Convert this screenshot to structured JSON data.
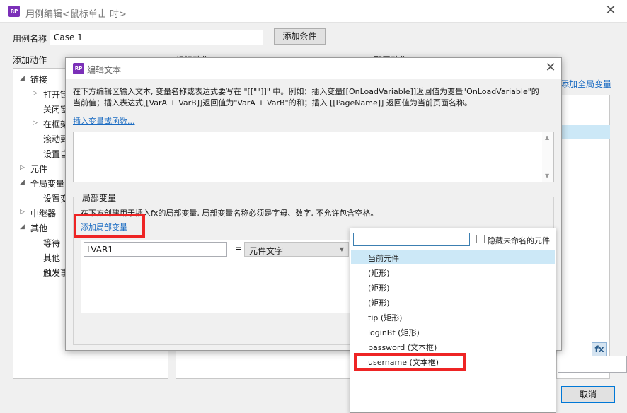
{
  "main_window": {
    "title": "用例编辑<鼠标单击 时>",
    "case_name_label": "用例名称",
    "case_name_value": "Case 1",
    "add_condition_label": "添加条件",
    "add_action_header": "添加动作",
    "organize_action_header": "组织动作",
    "config_action_header": "配置动作",
    "add_global_var_link": "添加全局变量",
    "cancel_label": "取消",
    "fx_label": "fx"
  },
  "tree": {
    "links": "链接",
    "open_link": "打开链",
    "close_window": "关闭窗",
    "in_frame": "在框架",
    "scroll_to": "滚动到",
    "set_adaptive": "设置自",
    "widgets": "元件",
    "global_var": "全局变量",
    "set_var": "设置变",
    "repeater": "中继器",
    "other": "其他",
    "wait": "等待",
    "other_sub": "其他",
    "trigger_event": "触发事"
  },
  "edit_dialog": {
    "title": "编辑文本",
    "instructions_line1": "在下方编辑区输入文本, 变量名称或表达式要写在 \"[[\"\"]]\" 中。例如：插入变量[[OnLoadVariable]]返回值为变量\"OnLoadVariable\"的",
    "instructions_line2": "当前值；插入表达式[[VarA + VarB]]返回值为\"VarA + VarB\"的和；插入 [[PageName]] 返回值为当前页面名称。",
    "insert_var_link": "插入变量或函数...",
    "local_vars_title": "局部变量",
    "local_vars_desc": "在下方创建用于插入fx的局部变量, 局部变量名称必须是字母、数字, 不允许包含空格。",
    "add_local_var_link": "添加局部变量",
    "var_name": "LVAR1",
    "equals": "=",
    "var_type": "元件文字"
  },
  "dropdown": {
    "search_value": "",
    "hide_unnamed_label": "隐藏未命名的元件",
    "items": [
      "当前元件",
      "(矩形)",
      "(矩形)",
      "(矩形)",
      "tip (矩形)",
      "loginBt (矩形)",
      "password (文本框)",
      "username (文本框)"
    ]
  },
  "colors": {
    "highlight": "#ee2424",
    "selected_row": "#cce8f7",
    "link": "#1a6bc2",
    "logo": "#7b2fb8"
  }
}
